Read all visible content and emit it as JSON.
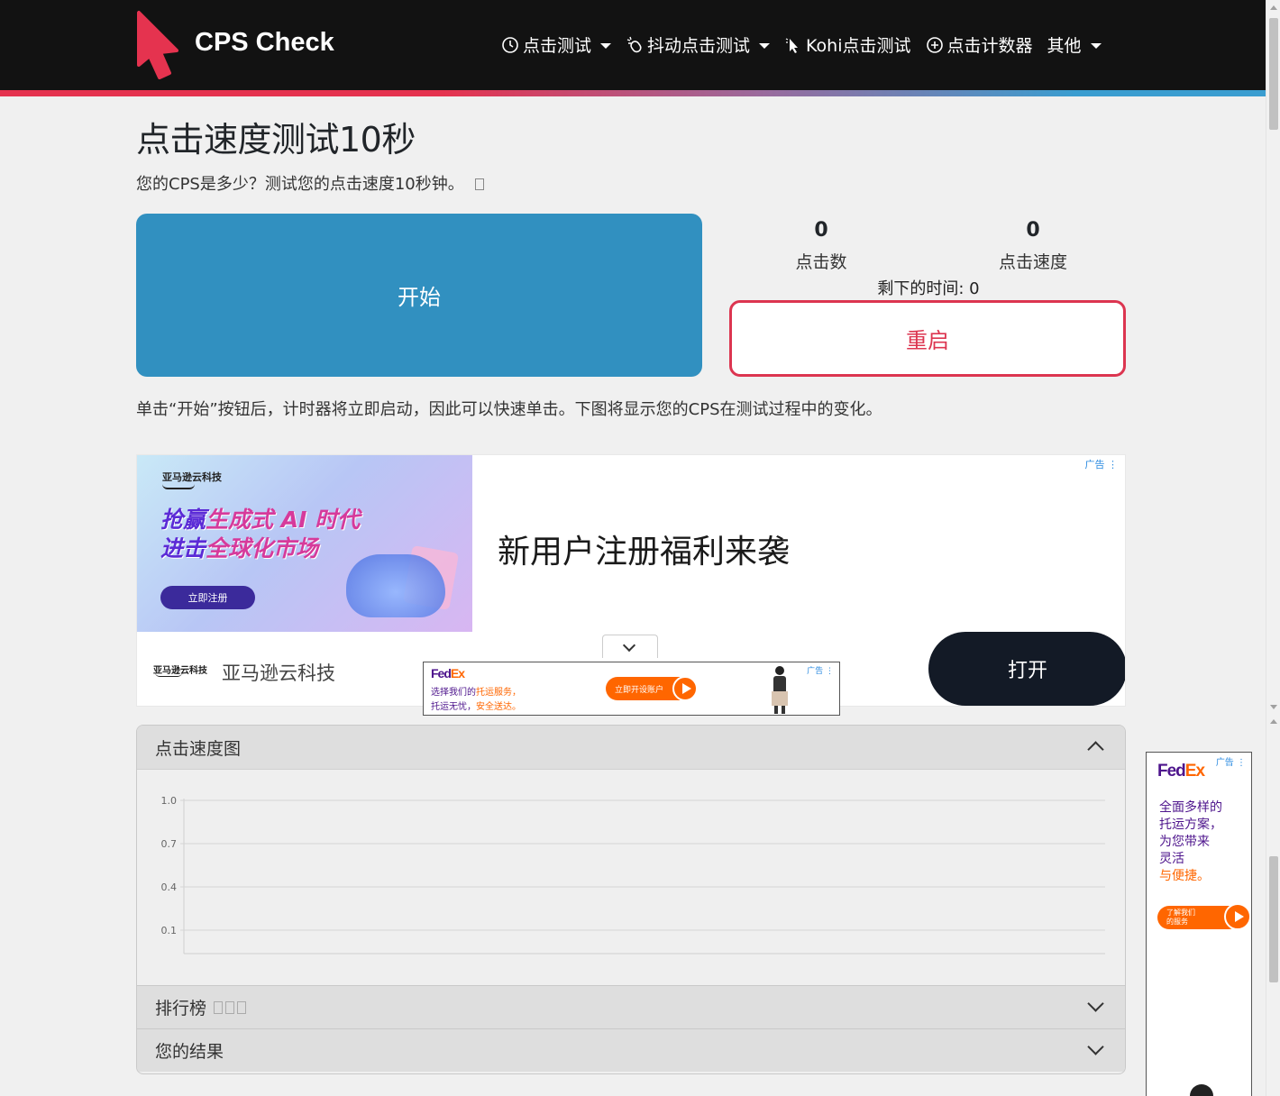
{
  "brand": {
    "name": "CPS Check",
    "accent_red": "#e5334f",
    "accent_blue": "#3a9dd0"
  },
  "nav": {
    "items": [
      {
        "label": "点击测试",
        "icon": "clock-icon",
        "dropdown": true
      },
      {
        "label": "抖动点击测试",
        "icon": "mouse-jitter-icon",
        "dropdown": true
      },
      {
        "label": "Kohi点击测试",
        "icon": "cursor-icon",
        "dropdown": false
      },
      {
        "label": "点击计数器",
        "icon": "plus-circle-icon",
        "dropdown": false
      },
      {
        "label": "其他",
        "icon": "",
        "dropdown": true
      }
    ]
  },
  "page": {
    "title": "点击速度测试10秒",
    "subtitle": "您的CPS是多少？测试您的点击速度10秒钟。",
    "start_label": "开始",
    "restart_label": "重启",
    "clicks": {
      "value": "0",
      "label": "点击数"
    },
    "speed": {
      "value": "0",
      "label": "点击速度"
    },
    "time_left": "剩下的时间: 0",
    "instructions": "单击“开始”按钮后，计时器将立即启动，因此可以快速单击。下图将显示您的CPS在测试过程中的变化。",
    "colors": {
      "start": "#3190c0",
      "restart": "#dc3550"
    }
  },
  "ad_main": {
    "label": "广告",
    "brand_small": "亚马逊云科技",
    "headline_line1_a": "抢赢",
    "headline_line1_b": "生成式 AI 时代",
    "headline_line2_a": "进击",
    "headline_line2_b": "全球化市场",
    "cta_small": "立即注册",
    "tagline": "新用户注册福利来袭",
    "footer_logo": "亚马逊云科技",
    "footer_name": "亚马逊云科技",
    "open_button": "打开"
  },
  "fedex_banner": {
    "label": "广告",
    "logo_fed": "Fed",
    "logo_ex": "Ex",
    "line1_a": "选择我们的",
    "line1_b": "托运服务，",
    "line2_a": "托运无忧，",
    "line2_b": "安全送达。",
    "cta": "立即开设账户"
  },
  "fedex_side": {
    "label": "广告",
    "logo_fed": "Fed",
    "logo_ex": "Ex",
    "lines": [
      "全面多样的",
      "托运方案，",
      "为您带来",
      "灵活",
      "与便捷。"
    ],
    "cta_line1": "了解我们",
    "cta_line2": "的服务"
  },
  "accordion": {
    "chart_title": "点击速度图",
    "leaderboard": "排行榜",
    "results": "您的结果"
  },
  "chart_data": {
    "type": "line",
    "title": "",
    "xlabel": "",
    "ylabel": "",
    "y_ticks": [
      "1.0",
      "0.7",
      "0.4",
      "0.1"
    ],
    "ylim": [
      0.1,
      1.0
    ],
    "series": [],
    "grid": true
  }
}
